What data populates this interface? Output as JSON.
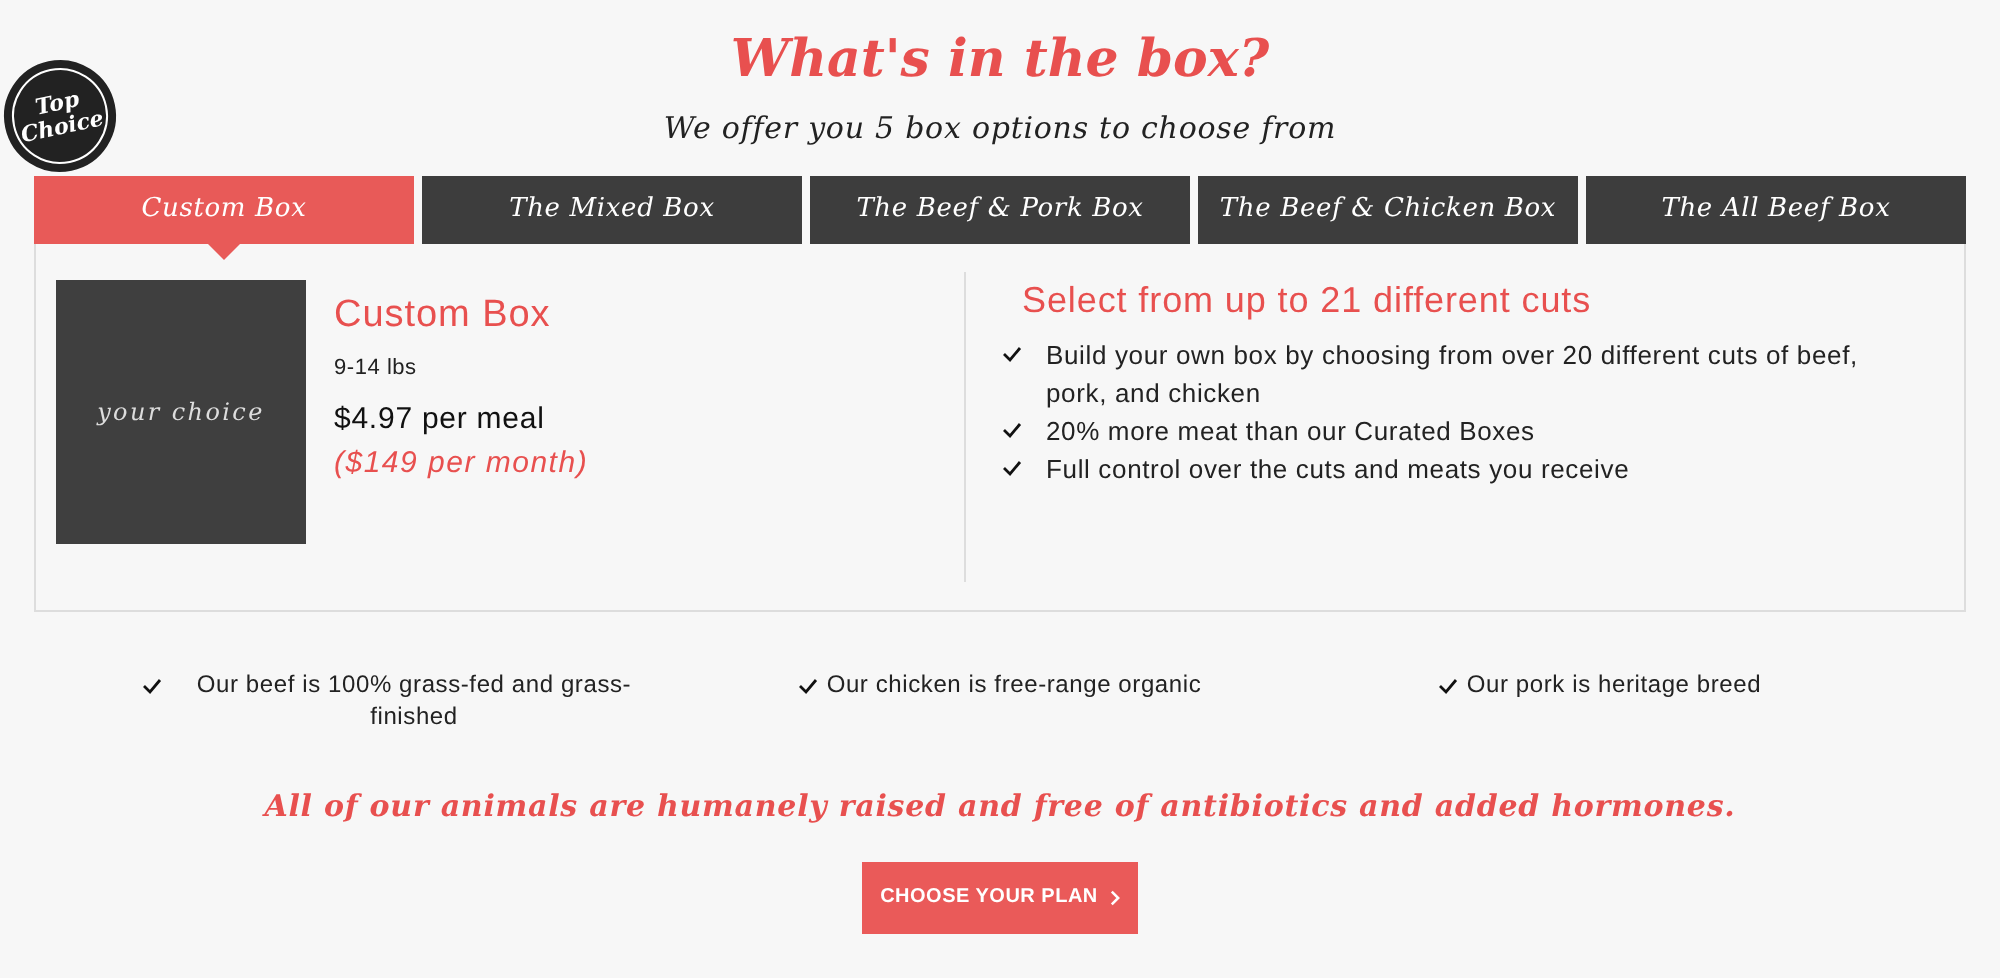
{
  "title": "What's in the box?",
  "subtitle": "We offer you 5 box options to choose from",
  "badge": "Top Choice",
  "tabs": [
    {
      "label": "Custom Box",
      "selected": true
    },
    {
      "label": "The Mixed Box",
      "selected": false
    },
    {
      "label": "The Beef & Pork Box",
      "selected": false
    },
    {
      "label": "The Beef & Chicken Box",
      "selected": false
    },
    {
      "label": "The All Beef Box",
      "selected": false
    }
  ],
  "box": {
    "image_text": "your choice",
    "name": "Custom Box",
    "weight": "9-14 lbs",
    "price": "$4.97 per meal",
    "monthly": "($149 per month)",
    "heading": "Select from up to 21 different cuts",
    "features": [
      "Build your own box by choosing from over 20 different cuts of beef, pork, and chicken",
      "20% more meat than our Curated Boxes",
      "Full control over the cuts and meats you receive"
    ]
  },
  "highlights": [
    "Our beef is 100% grass-fed and grass-finished",
    "Our chicken is free-range organic",
    "Our pork is heritage breed"
  ],
  "tagline": "All of our animals are humanely raised and free of antibiotics and added hormones.",
  "cta": "CHOOSE YOUR PLAN"
}
